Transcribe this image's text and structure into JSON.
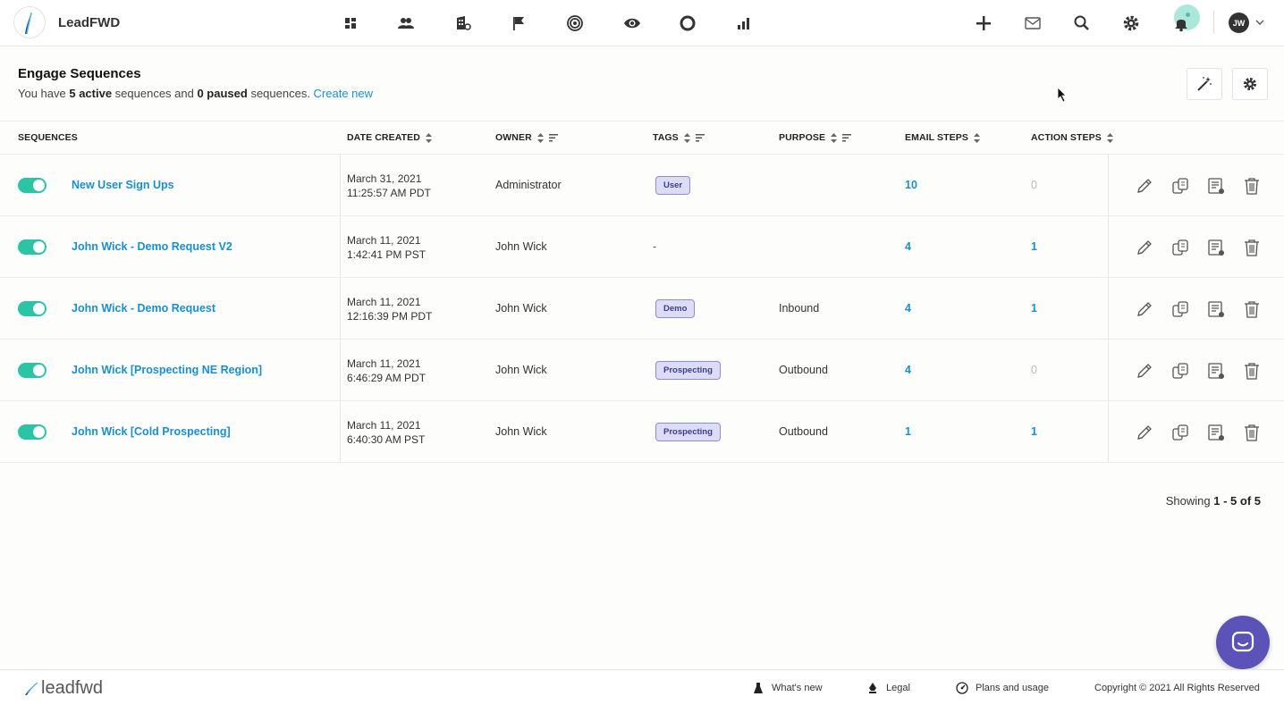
{
  "app": {
    "brand": "LeadFWD",
    "footer_brand": "leadfwd"
  },
  "nav": {
    "icons": [
      "dashboard-icon",
      "people-icon",
      "buildings-icon",
      "flag-icon",
      "target-icon",
      "eye-icon",
      "circle-icon",
      "bar-chart-icon"
    ],
    "right_icons": [
      "plus-icon",
      "mail-icon",
      "search-icon",
      "gear-icon",
      "bell-icon"
    ],
    "user_initials": "JW"
  },
  "header": {
    "title": "Engage Sequences",
    "sub_prefix": "You have ",
    "active_count": "5 active",
    "sub_mid": " sequences and ",
    "paused_count": "0 paused",
    "sub_suffix": " sequences. ",
    "create_link": "Create new"
  },
  "table": {
    "columns": {
      "sequences": "SEQUENCES",
      "date_created": "DATE CREATED",
      "owner": "OWNER",
      "tags": "TAGS",
      "purpose": "PURPOSE",
      "email_steps": "EMAIL STEPS",
      "action_steps": "ACTION STEPS"
    },
    "rows": [
      {
        "name": "New User Sign Ups",
        "date": "March 31, 2021",
        "time": "11:25:57 AM PDT",
        "owner": "Administrator",
        "tag": "User",
        "purpose": "",
        "email_steps": "10",
        "action_steps": "0",
        "enabled": true
      },
      {
        "name": "John Wick - Demo Request V2",
        "date": "March 11, 2021",
        "time": "1:42:41 PM PST",
        "owner": "John Wick",
        "tag": "-",
        "purpose": "",
        "email_steps": "4",
        "action_steps": "1",
        "enabled": true
      },
      {
        "name": "John Wick - Demo Request",
        "date": "March 11, 2021",
        "time": "12:16:39 PM PDT",
        "owner": "John Wick",
        "tag": "Demo",
        "purpose": "Inbound",
        "email_steps": "4",
        "action_steps": "1",
        "enabled": true
      },
      {
        "name": "John Wick [Prospecting NE Region]",
        "date": "March 11, 2021",
        "time": "6:46:29 AM PDT",
        "owner": "John Wick",
        "tag": "Prospecting",
        "purpose": "Outbound",
        "email_steps": "4",
        "action_steps": "0",
        "enabled": true
      },
      {
        "name": "John Wick [Cold Prospecting]",
        "date": "March 11, 2021",
        "time": "6:40:30 AM PST",
        "owner": "John Wick",
        "tag": "Prospecting",
        "purpose": "Outbound",
        "email_steps": "1",
        "action_steps": "1",
        "enabled": true
      }
    ]
  },
  "pagination": {
    "prefix": "Showing ",
    "range": "1 - 5 of 5"
  },
  "footer": {
    "whats_new": "What's new",
    "legal": "Legal",
    "plans": "Plans and usage",
    "copyright": "Copyright © 2021 All Rights Reserved"
  },
  "colors": {
    "accent": "#1a8fd0",
    "toggle_on": "#2bc4a4",
    "tag_bg": "#dcdcf7",
    "chat": "#5b53b8"
  }
}
